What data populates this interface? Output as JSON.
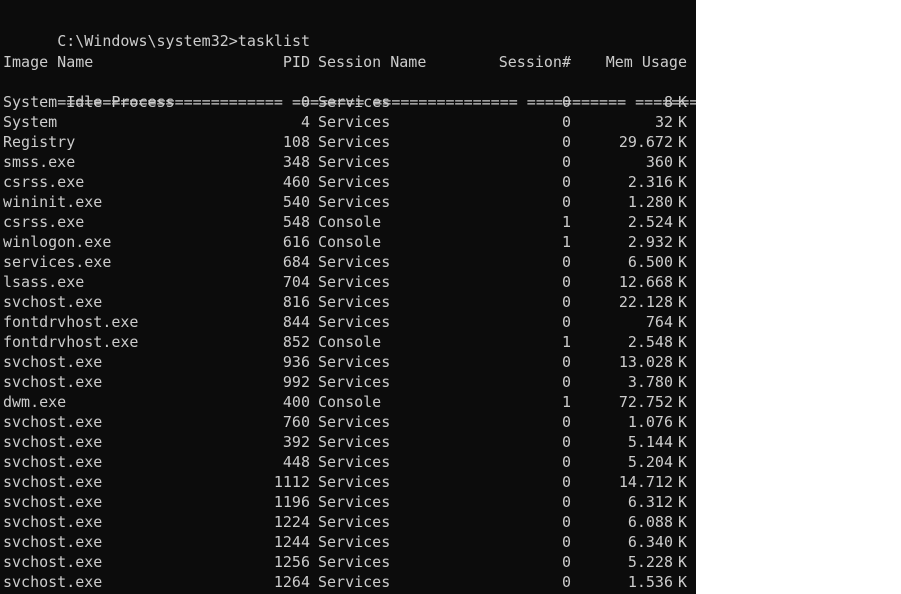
{
  "terminal": {
    "prompt": "C:\\Windows\\system32>tasklist",
    "headers": {
      "image_name": "Image Name",
      "pid": "PID",
      "session_name": "Session Name",
      "session_num": "Session#",
      "mem_usage": "Mem Usage"
    },
    "separator": "========================= ======== ================ =========== ============",
    "unit": "K",
    "rows": [
      {
        "name": "System Idle Process",
        "pid": "0",
        "session": "Services",
        "num": "0",
        "mem": "8"
      },
      {
        "name": "System",
        "pid": "4",
        "session": "Services",
        "num": "0",
        "mem": "32"
      },
      {
        "name": "Registry",
        "pid": "108",
        "session": "Services",
        "num": "0",
        "mem": "29.672"
      },
      {
        "name": "smss.exe",
        "pid": "348",
        "session": "Services",
        "num": "0",
        "mem": "360"
      },
      {
        "name": "csrss.exe",
        "pid": "460",
        "session": "Services",
        "num": "0",
        "mem": "2.316"
      },
      {
        "name": "wininit.exe",
        "pid": "540",
        "session": "Services",
        "num": "0",
        "mem": "1.280"
      },
      {
        "name": "csrss.exe",
        "pid": "548",
        "session": "Console",
        "num": "1",
        "mem": "2.524"
      },
      {
        "name": "winlogon.exe",
        "pid": "616",
        "session": "Console",
        "num": "1",
        "mem": "2.932"
      },
      {
        "name": "services.exe",
        "pid": "684",
        "session": "Services",
        "num": "0",
        "mem": "6.500"
      },
      {
        "name": "lsass.exe",
        "pid": "704",
        "session": "Services",
        "num": "0",
        "mem": "12.668"
      },
      {
        "name": "svchost.exe",
        "pid": "816",
        "session": "Services",
        "num": "0",
        "mem": "22.128"
      },
      {
        "name": "fontdrvhost.exe",
        "pid": "844",
        "session": "Services",
        "num": "0",
        "mem": "764"
      },
      {
        "name": "fontdrvhost.exe",
        "pid": "852",
        "session": "Console",
        "num": "1",
        "mem": "2.548"
      },
      {
        "name": "svchost.exe",
        "pid": "936",
        "session": "Services",
        "num": "0",
        "mem": "13.028"
      },
      {
        "name": "svchost.exe",
        "pid": "992",
        "session": "Services",
        "num": "0",
        "mem": "3.780"
      },
      {
        "name": "dwm.exe",
        "pid": "400",
        "session": "Console",
        "num": "1",
        "mem": "72.752"
      },
      {
        "name": "svchost.exe",
        "pid": "760",
        "session": "Services",
        "num": "0",
        "mem": "1.076"
      },
      {
        "name": "svchost.exe",
        "pid": "392",
        "session": "Services",
        "num": "0",
        "mem": "5.144"
      },
      {
        "name": "svchost.exe",
        "pid": "448",
        "session": "Services",
        "num": "0",
        "mem": "5.204"
      },
      {
        "name": "svchost.exe",
        "pid": "1112",
        "session": "Services",
        "num": "0",
        "mem": "14.712"
      },
      {
        "name": "svchost.exe",
        "pid": "1196",
        "session": "Services",
        "num": "0",
        "mem": "6.312"
      },
      {
        "name": "svchost.exe",
        "pid": "1224",
        "session": "Services",
        "num": "0",
        "mem": "6.088"
      },
      {
        "name": "svchost.exe",
        "pid": "1244",
        "session": "Services",
        "num": "0",
        "mem": "6.340"
      },
      {
        "name": "svchost.exe",
        "pid": "1256",
        "session": "Services",
        "num": "0",
        "mem": "5.228"
      },
      {
        "name": "svchost.exe",
        "pid": "1264",
        "session": "Services",
        "num": "0",
        "mem": "1.536"
      }
    ]
  },
  "colors": {
    "background": "#0c0c0c",
    "foreground": "#cccccc"
  }
}
